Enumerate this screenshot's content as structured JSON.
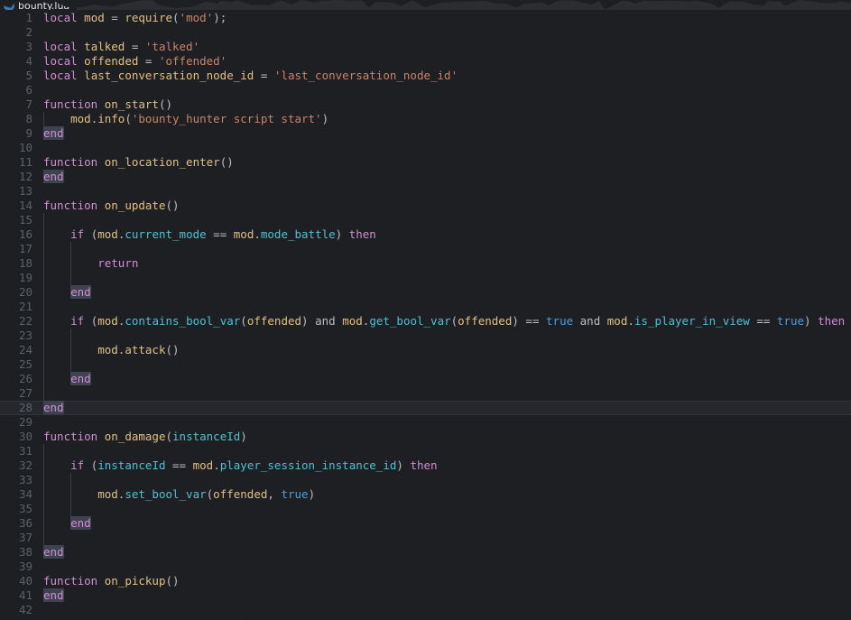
{
  "window": {
    "title": "bounty.lua",
    "background_color": "#1e1f22",
    "tabbar_background_color": "#2b2d30"
  },
  "tab": {
    "label": "bounty.lua",
    "icon": "lua-moon-icon",
    "active": true
  },
  "editor": {
    "language": "Lua",
    "first_visible_line": 1,
    "last_visible_line": 42,
    "current_line": 28,
    "gutter_color": "#5a6169",
    "theme_colors": {
      "keyword": "#cf8ed1",
      "function": "#e0c184",
      "string": "#c9836a",
      "property": "#4fc1d4",
      "boolean": "#4b9fe0",
      "default": "#bcbec4",
      "occurrence_highlight": "#3e4350",
      "caret_row": "#26282e"
    },
    "lines": [
      {
        "n": 1,
        "tokens": [
          {
            "t": "local",
            "c": "kw"
          },
          {
            "t": " ",
            "c": "def"
          },
          {
            "t": "mod",
            "c": "fn"
          },
          {
            "t": " = ",
            "c": "def"
          },
          {
            "t": "require",
            "c": "fn"
          },
          {
            "t": "(",
            "c": "punc"
          },
          {
            "t": "'mod'",
            "c": "str"
          },
          {
            "t": ");",
            "c": "punc"
          }
        ]
      },
      {
        "n": 2,
        "tokens": []
      },
      {
        "n": 3,
        "tokens": [
          {
            "t": "local",
            "c": "kw"
          },
          {
            "t": " ",
            "c": "def"
          },
          {
            "t": "talked",
            "c": "fn"
          },
          {
            "t": " = ",
            "c": "def"
          },
          {
            "t": "'talked'",
            "c": "str"
          }
        ]
      },
      {
        "n": 4,
        "tokens": [
          {
            "t": "local",
            "c": "kw"
          },
          {
            "t": " ",
            "c": "def"
          },
          {
            "t": "offended",
            "c": "fn"
          },
          {
            "t": " = ",
            "c": "def"
          },
          {
            "t": "'offended'",
            "c": "str"
          }
        ]
      },
      {
        "n": 5,
        "tokens": [
          {
            "t": "local",
            "c": "kw"
          },
          {
            "t": " ",
            "c": "def"
          },
          {
            "t": "last_conversation_node_id",
            "c": "fn"
          },
          {
            "t": " = ",
            "c": "def"
          },
          {
            "t": "'last_conversation_node_id'",
            "c": "str"
          }
        ]
      },
      {
        "n": 6,
        "tokens": []
      },
      {
        "n": 7,
        "tokens": [
          {
            "t": "function",
            "c": "kw"
          },
          {
            "t": " ",
            "c": "def"
          },
          {
            "t": "on_start",
            "c": "fn"
          },
          {
            "t": "()",
            "c": "punc"
          }
        ]
      },
      {
        "n": 8,
        "tokens": [
          {
            "t": "    ",
            "c": "def"
          },
          {
            "t": "mod",
            "c": "fn"
          },
          {
            "t": ".",
            "c": "punc"
          },
          {
            "t": "info",
            "c": "fn"
          },
          {
            "t": "(",
            "c": "punc"
          },
          {
            "t": "'bounty_hunter script start'",
            "c": "str"
          },
          {
            "t": ")",
            "c": "punc"
          }
        ],
        "guides": [
          1
        ]
      },
      {
        "n": 9,
        "tokens": [
          {
            "t": "end",
            "c": "kw",
            "hl": true
          }
        ]
      },
      {
        "n": 10,
        "tokens": []
      },
      {
        "n": 11,
        "tokens": [
          {
            "t": "function",
            "c": "kw"
          },
          {
            "t": " ",
            "c": "def"
          },
          {
            "t": "on_location_enter",
            "c": "fn"
          },
          {
            "t": "()",
            "c": "punc"
          }
        ]
      },
      {
        "n": 12,
        "tokens": [
          {
            "t": "end",
            "c": "kw",
            "hl": true
          }
        ]
      },
      {
        "n": 13,
        "tokens": []
      },
      {
        "n": 14,
        "tokens": [
          {
            "t": "function",
            "c": "kw"
          },
          {
            "t": " ",
            "c": "def"
          },
          {
            "t": "on_update",
            "c": "fn"
          },
          {
            "t": "()",
            "c": "punc"
          }
        ]
      },
      {
        "n": 15,
        "tokens": [],
        "guides": [
          1
        ]
      },
      {
        "n": 16,
        "tokens": [
          {
            "t": "    ",
            "c": "def"
          },
          {
            "t": "if",
            "c": "kw"
          },
          {
            "t": " (",
            "c": "punc"
          },
          {
            "t": "mod",
            "c": "fn"
          },
          {
            "t": ".",
            "c": "punc"
          },
          {
            "t": "current_mode",
            "c": "prop"
          },
          {
            "t": " == ",
            "c": "def"
          },
          {
            "t": "mod",
            "c": "fn"
          },
          {
            "t": ".",
            "c": "punc"
          },
          {
            "t": "mode_battle",
            "c": "prop"
          },
          {
            "t": ") ",
            "c": "punc"
          },
          {
            "t": "then",
            "c": "kw"
          }
        ],
        "guides": [
          1
        ]
      },
      {
        "n": 17,
        "tokens": [],
        "guides": [
          1,
          2
        ]
      },
      {
        "n": 18,
        "tokens": [
          {
            "t": "        ",
            "c": "def"
          },
          {
            "t": "return",
            "c": "kw"
          }
        ],
        "guides": [
          1,
          2
        ]
      },
      {
        "n": 19,
        "tokens": [],
        "guides": [
          1,
          2
        ]
      },
      {
        "n": 20,
        "tokens": [
          {
            "t": "    ",
            "c": "def"
          },
          {
            "t": "end",
            "c": "kw",
            "hl": true
          }
        ],
        "guides": [
          1
        ]
      },
      {
        "n": 21,
        "tokens": [],
        "guides": [
          1
        ]
      },
      {
        "n": 22,
        "tokens": [
          {
            "t": "    ",
            "c": "def"
          },
          {
            "t": "if",
            "c": "kw"
          },
          {
            "t": " (",
            "c": "punc"
          },
          {
            "t": "mod",
            "c": "fn"
          },
          {
            "t": ".",
            "c": "punc"
          },
          {
            "t": "contains_bool_var",
            "c": "prop"
          },
          {
            "t": "(",
            "c": "punc"
          },
          {
            "t": "offended",
            "c": "fn"
          },
          {
            "t": ") ",
            "c": "punc"
          },
          {
            "t": "and",
            "c": "def"
          },
          {
            "t": " ",
            "c": "def"
          },
          {
            "t": "mod",
            "c": "fn"
          },
          {
            "t": ".",
            "c": "punc"
          },
          {
            "t": "get_bool_var",
            "c": "prop"
          },
          {
            "t": "(",
            "c": "punc"
          },
          {
            "t": "offended",
            "c": "fn"
          },
          {
            "t": ") == ",
            "c": "def"
          },
          {
            "t": "true",
            "c": "num"
          },
          {
            "t": " and ",
            "c": "def"
          },
          {
            "t": "mod",
            "c": "fn"
          },
          {
            "t": ".",
            "c": "punc"
          },
          {
            "t": "is_player_in_view",
            "c": "prop"
          },
          {
            "t": " == ",
            "c": "def"
          },
          {
            "t": "true",
            "c": "num"
          },
          {
            "t": ") ",
            "c": "punc"
          },
          {
            "t": "then",
            "c": "kw"
          }
        ],
        "guides": [
          1
        ]
      },
      {
        "n": 23,
        "tokens": [],
        "guides": [
          1,
          2
        ]
      },
      {
        "n": 24,
        "tokens": [
          {
            "t": "        ",
            "c": "def"
          },
          {
            "t": "mod",
            "c": "fn"
          },
          {
            "t": ".",
            "c": "punc"
          },
          {
            "t": "attack",
            "c": "fn"
          },
          {
            "t": "()",
            "c": "punc"
          }
        ],
        "guides": [
          1,
          2
        ]
      },
      {
        "n": 25,
        "tokens": [],
        "guides": [
          1,
          2
        ]
      },
      {
        "n": 26,
        "tokens": [
          {
            "t": "    ",
            "c": "def"
          },
          {
            "t": "end",
            "c": "kw",
            "hl": true
          }
        ],
        "guides": [
          1
        ]
      },
      {
        "n": 27,
        "tokens": [],
        "guides": [
          1
        ]
      },
      {
        "n": 28,
        "tokens": [
          {
            "t": "end",
            "c": "kw",
            "hl": true
          }
        ],
        "current": true
      },
      {
        "n": 29,
        "tokens": []
      },
      {
        "n": 30,
        "tokens": [
          {
            "t": "function",
            "c": "kw"
          },
          {
            "t": " ",
            "c": "def"
          },
          {
            "t": "on_damage",
            "c": "fn"
          },
          {
            "t": "(",
            "c": "punc"
          },
          {
            "t": "instanceId",
            "c": "prop"
          },
          {
            "t": ")",
            "c": "punc"
          }
        ]
      },
      {
        "n": 31,
        "tokens": [],
        "guides": [
          1
        ]
      },
      {
        "n": 32,
        "tokens": [
          {
            "t": "    ",
            "c": "def"
          },
          {
            "t": "if",
            "c": "kw"
          },
          {
            "t": " (",
            "c": "punc"
          },
          {
            "t": "instanceId",
            "c": "prop"
          },
          {
            "t": " == ",
            "c": "def"
          },
          {
            "t": "mod",
            "c": "fn"
          },
          {
            "t": ".",
            "c": "punc"
          },
          {
            "t": "player_session_instance_id",
            "c": "prop"
          },
          {
            "t": ") ",
            "c": "punc"
          },
          {
            "t": "then",
            "c": "kw"
          }
        ],
        "guides": [
          1
        ]
      },
      {
        "n": 33,
        "tokens": [],
        "guides": [
          1,
          2
        ]
      },
      {
        "n": 34,
        "tokens": [
          {
            "t": "        ",
            "c": "def"
          },
          {
            "t": "mod",
            "c": "fn"
          },
          {
            "t": ".",
            "c": "punc"
          },
          {
            "t": "set_bool_var",
            "c": "prop"
          },
          {
            "t": "(",
            "c": "punc"
          },
          {
            "t": "offended",
            "c": "fn"
          },
          {
            "t": ", ",
            "c": "punc"
          },
          {
            "t": "true",
            "c": "num"
          },
          {
            "t": ")",
            "c": "punc"
          }
        ],
        "guides": [
          1,
          2
        ]
      },
      {
        "n": 35,
        "tokens": [],
        "guides": [
          1,
          2
        ]
      },
      {
        "n": 36,
        "tokens": [
          {
            "t": "    ",
            "c": "def"
          },
          {
            "t": "end",
            "c": "kw",
            "hl": true
          }
        ],
        "guides": [
          1
        ]
      },
      {
        "n": 37,
        "tokens": [],
        "guides": [
          1
        ]
      },
      {
        "n": 38,
        "tokens": [
          {
            "t": "end",
            "c": "kw",
            "hl": true
          }
        ]
      },
      {
        "n": 39,
        "tokens": []
      },
      {
        "n": 40,
        "tokens": [
          {
            "t": "function",
            "c": "kw"
          },
          {
            "t": " ",
            "c": "def"
          },
          {
            "t": "on_pickup",
            "c": "fn"
          },
          {
            "t": "()",
            "c": "punc"
          }
        ]
      },
      {
        "n": 41,
        "tokens": [
          {
            "t": "end",
            "c": "kw",
            "hl": true
          }
        ]
      },
      {
        "n": 42,
        "tokens": []
      }
    ]
  }
}
